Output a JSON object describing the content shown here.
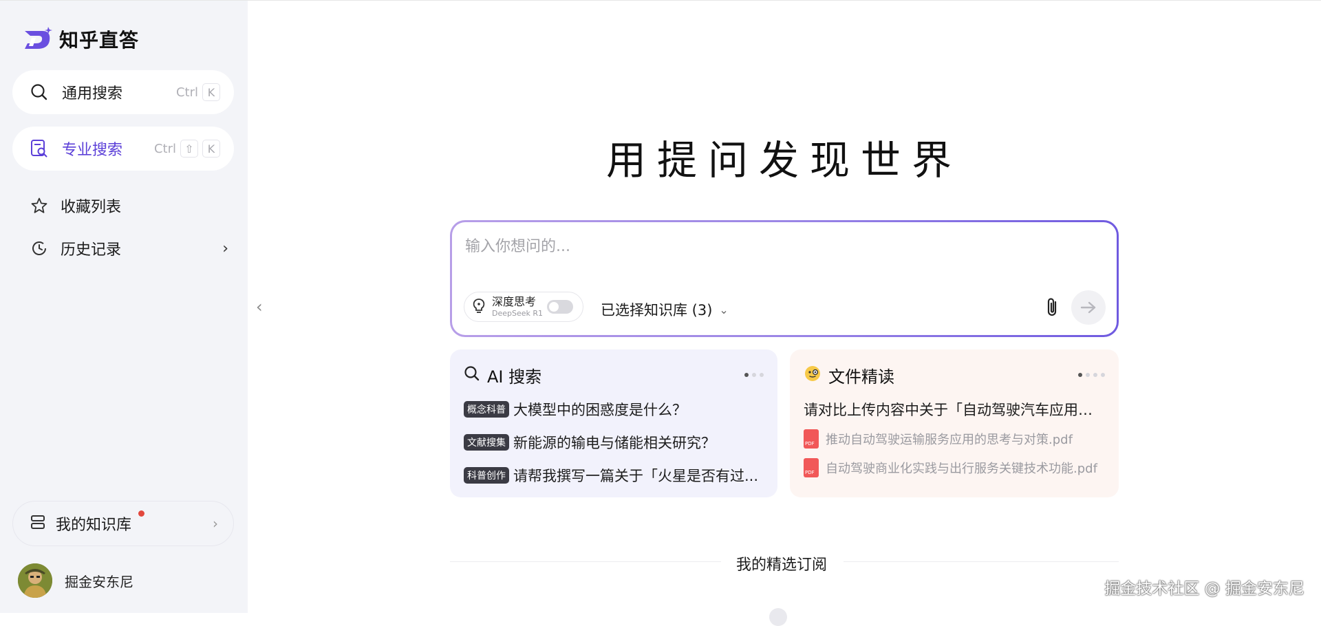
{
  "brand": {
    "name": "知乎直答",
    "accent": "#5b3fd8"
  },
  "sidebar": {
    "general_search": {
      "label": "通用搜索",
      "shortcut": [
        "Ctrl",
        "K"
      ]
    },
    "pro_search": {
      "label": "专业搜索",
      "shortcut": [
        "Ctrl",
        "⇧",
        "K"
      ]
    },
    "favorites": {
      "label": "收藏列表"
    },
    "history": {
      "label": "历史记录"
    },
    "knowledge_base": {
      "label": "我的知识库",
      "has_badge": true
    },
    "user": {
      "name": "掘金安东尼"
    }
  },
  "main": {
    "headline": "用提问发现世界",
    "input": {
      "placeholder": "输入你想问的...",
      "value": ""
    },
    "deep_think": {
      "title": "深度思考",
      "subtitle": "DeepSeek R1",
      "enabled": false
    },
    "kb_select": {
      "label": "已选择知识库 (3)"
    },
    "cards": {
      "ai_search": {
        "title": "AI 搜索",
        "items": [
          {
            "tag": "概念科普",
            "text": "大模型中的困惑度是什么？"
          },
          {
            "tag": "文献搜集",
            "text": "新能源的输电与储能相关研究？"
          },
          {
            "tag": "科普创作",
            "text": "请帮我撰写一篇关于「火星是否有过..."
          }
        ]
      },
      "doc_read": {
        "title": "文件精读",
        "question": "请对比上传内容中关于「自动驾驶汽车应用障...",
        "files": [
          "推动自动驾驶运输服务应用的思考与对策.pdf",
          "自动驾驶商业化实践与出行服务关键技术功能.pdf"
        ]
      }
    },
    "subscriptions_title": "我的精选订阅"
  },
  "watermark": "掘金技术社区 @ 掘金安东尼"
}
